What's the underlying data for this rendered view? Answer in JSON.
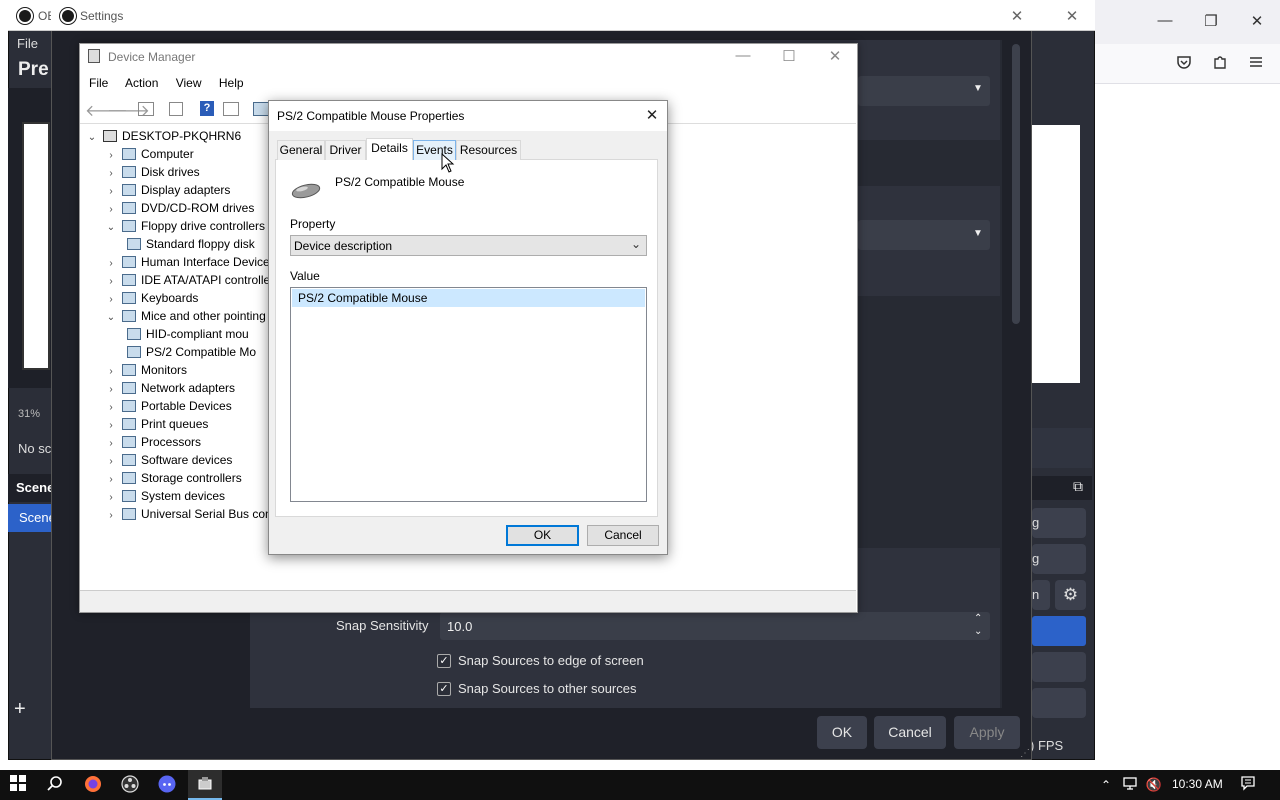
{
  "firefox": {
    "minimize": "—",
    "restore": "❐",
    "close": "✕",
    "toolbar_icons": [
      "pocket-icon",
      "extensions-icon",
      "menu-icon"
    ]
  },
  "obs": {
    "title": "OB",
    "menu_file": "File",
    "heading": "Pre",
    "zoom": "31%",
    "no_source": "No sc",
    "scenes_header": "Scene",
    "scene_item": "Scene",
    "fps": ") FPS",
    "side_btn_1": "g",
    "side_btn_2": "g",
    "side_btn_3": "n"
  },
  "settings": {
    "title": "Settings",
    "snap_sensitivity_label": "Snap Sensitivity",
    "snap_sensitivity_value": "10.0",
    "snap_edge_label": "Snap Sources to edge of screen",
    "snap_other_label": "Snap Sources to other sources",
    "ok": "OK",
    "cancel": "Cancel",
    "apply": "Apply"
  },
  "device_manager": {
    "title": "Device Manager",
    "menu": [
      "File",
      "Action",
      "View",
      "Help"
    ],
    "root": "DESKTOP-PKQHRN6",
    "tree": [
      {
        "label": "Computer",
        "level": 1,
        "expanded": false
      },
      {
        "label": "Disk drives",
        "level": 1,
        "expanded": false
      },
      {
        "label": "Display adapters",
        "level": 1,
        "expanded": false
      },
      {
        "label": "DVD/CD-ROM drives",
        "level": 1,
        "expanded": false
      },
      {
        "label": "Floppy drive controllers",
        "level": 1,
        "expanded": true
      },
      {
        "label": "Standard floppy disk",
        "level": 2,
        "expanded": null
      },
      {
        "label": "Human Interface Device",
        "level": 1,
        "expanded": false
      },
      {
        "label": "IDE ATA/ATAPI controlle",
        "level": 1,
        "expanded": false
      },
      {
        "label": "Keyboards",
        "level": 1,
        "expanded": false
      },
      {
        "label": "Mice and other pointing",
        "level": 1,
        "expanded": true
      },
      {
        "label": "HID-compliant mou",
        "level": 2,
        "expanded": null
      },
      {
        "label": "PS/2 Compatible Mo",
        "level": 2,
        "expanded": null
      },
      {
        "label": "Monitors",
        "level": 1,
        "expanded": false
      },
      {
        "label": "Network adapters",
        "level": 1,
        "expanded": false
      },
      {
        "label": "Portable Devices",
        "level": 1,
        "expanded": false
      },
      {
        "label": "Print queues",
        "level": 1,
        "expanded": false
      },
      {
        "label": "Processors",
        "level": 1,
        "expanded": false
      },
      {
        "label": "Software devices",
        "level": 1,
        "expanded": false
      },
      {
        "label": "Storage controllers",
        "level": 1,
        "expanded": false
      },
      {
        "label": "System devices",
        "level": 1,
        "expanded": false
      },
      {
        "label": "Universal Serial Bus cont",
        "level": 1,
        "expanded": false
      }
    ]
  },
  "properties": {
    "title": "PS/2 Compatible Mouse Properties",
    "tabs": [
      "General",
      "Driver",
      "Details",
      "Events",
      "Resources"
    ],
    "active_tab": "Details",
    "device_name": "PS/2 Compatible Mouse",
    "property_label": "Property",
    "property_value": "Device description",
    "value_label": "Value",
    "value_item": "PS/2 Compatible Mouse",
    "ok": "OK",
    "cancel": "Cancel",
    "close": "✕"
  },
  "taskbar": {
    "time": "10:30 AM",
    "icons": [
      "windows-start-icon",
      "search-icon",
      "firefox-icon",
      "obs-icon",
      "discord-icon",
      "device-manager-icon"
    ]
  }
}
